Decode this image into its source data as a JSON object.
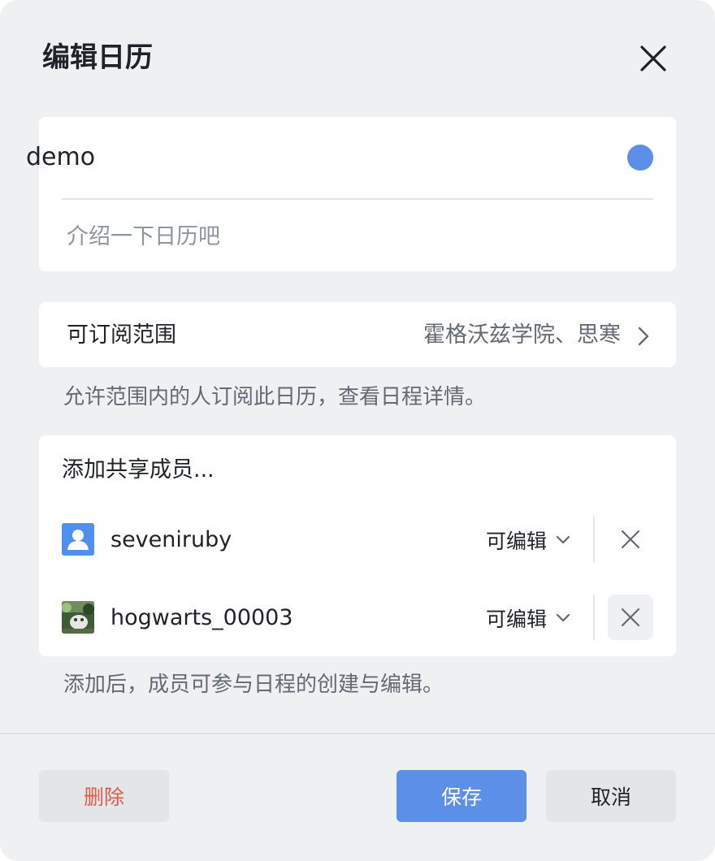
{
  "dialog": {
    "title": "编辑日历"
  },
  "calendar": {
    "name": "demo",
    "color": "#5b8fe8",
    "description_placeholder": "介绍一下日历吧"
  },
  "scope": {
    "label": "可订阅范围",
    "value": "霍格沃兹学院、思寒",
    "hint": "允许范围内的人订阅此日历，查看日程详情。"
  },
  "members": {
    "add_label": "添加共享成员...",
    "items": [
      {
        "name": "seveniruby",
        "permission": "可编辑",
        "avatar": "default-user-icon"
      },
      {
        "name": "hogwarts_00003",
        "permission": "可编辑",
        "avatar": "photo-avatar"
      }
    ],
    "hint": "添加后，成员可参与日程的创建与编辑。"
  },
  "footer": {
    "delete_label": "删除",
    "save_label": "保存",
    "cancel_label": "取消"
  },
  "colors": {
    "accent": "#5b8fe8",
    "danger": "#e05b4b",
    "background": "#eff0f2"
  }
}
